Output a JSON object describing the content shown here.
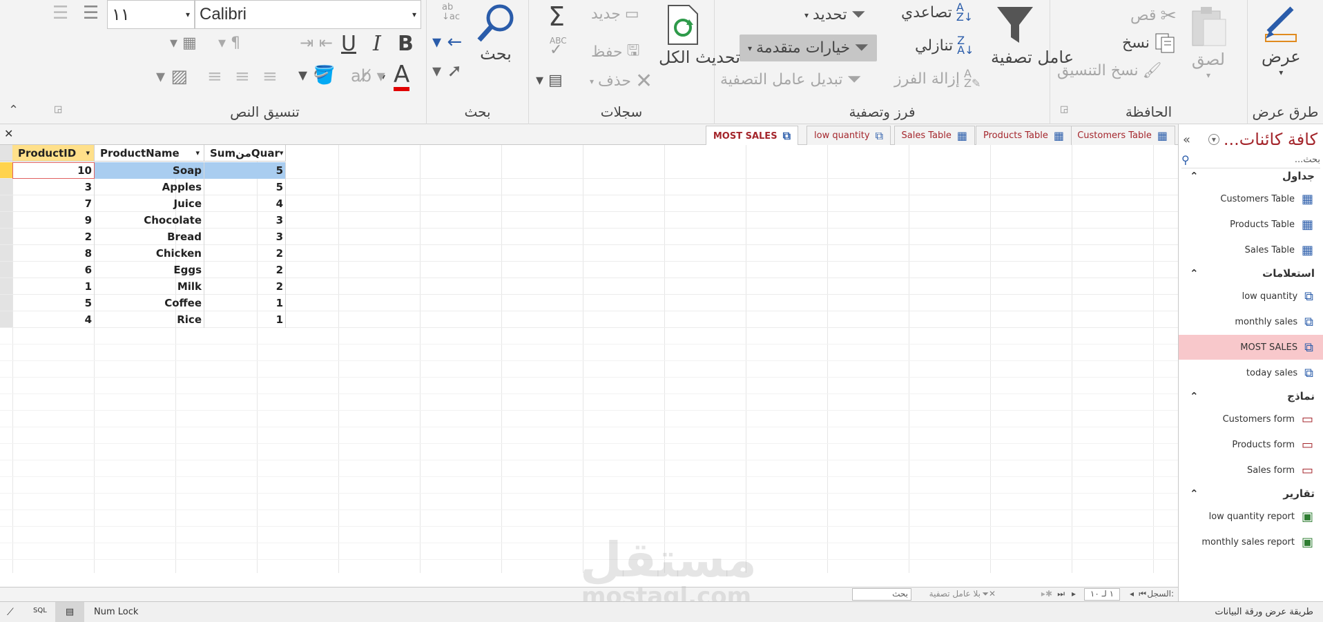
{
  "ribbon": {
    "views": {
      "label": "عرض",
      "group": "طرق عرض"
    },
    "clipboard": {
      "paste": "لصق",
      "cut": "قص",
      "copy": "نسخ",
      "format_painter": "نسخ التنسيق",
      "group": "الحافظة"
    },
    "sort_filter": {
      "filter": "عامل تصفية",
      "ascending": "تصاعدي",
      "descending": "تنازلي",
      "remove_sort": "إزالة الفرز",
      "selection": "تحديد",
      "advanced": "خيارات متقدمة",
      "toggle_filter": "تبديل عامل التصفية",
      "group": "فرز وتصفية"
    },
    "records": {
      "refresh_all": "تحديث الكل",
      "new": "جديد",
      "save": "حفظ",
      "delete": "حذف",
      "group": "سجلات"
    },
    "find": {
      "find": "بحث",
      "group": "بحث"
    },
    "text_formatting": {
      "font_name": "Calibri",
      "font_size": "١١",
      "group": "تنسيق النص",
      "bold": "B",
      "italic": "I",
      "underline": "U",
      "font_color": "A"
    }
  },
  "nav_pane": {
    "title": "كافة كائنات...",
    "search_placeholder": "بحث...",
    "sections": [
      {
        "title": "جداول",
        "items": [
          "Customers Table",
          "Products Table",
          "Sales Table"
        ]
      },
      {
        "title": "استعلامات",
        "items": [
          "low quantity",
          "monthly sales",
          "MOST SALES",
          "today sales"
        ]
      },
      {
        "title": "نماذج",
        "items": [
          "Customers form",
          "Products form",
          "Sales form"
        ]
      },
      {
        "title": "تقارير",
        "items": [
          "low quantity report",
          "monthly sales report"
        ]
      }
    ],
    "selected": "MOST SALES"
  },
  "tabs": [
    "Customers Table",
    "Products Table",
    "Sales Table",
    "low quantity",
    "MOST SALES"
  ],
  "active_tab": "MOST SALES",
  "grid": {
    "columns": [
      "ProductID",
      "ProductName",
      "SumمنQuar"
    ],
    "rows": [
      [
        "10",
        "Soap",
        "5"
      ],
      [
        "3",
        "Apples",
        "5"
      ],
      [
        "7",
        "Juice",
        "4"
      ],
      [
        "9",
        "Chocolate",
        "3"
      ],
      [
        "2",
        "Bread",
        "3"
      ],
      [
        "8",
        "Chicken",
        "2"
      ],
      [
        "6",
        "Eggs",
        "2"
      ],
      [
        "1",
        "Milk",
        "2"
      ],
      [
        "5",
        "Coffee",
        "1"
      ],
      [
        "4",
        "Rice",
        "1"
      ]
    ]
  },
  "record_nav": {
    "label": "السجل:",
    "position": "١ لـ ١٠",
    "filter": "بلا عامل تصفية",
    "search": "بحث"
  },
  "status": {
    "view_name": "طريقة عرض ورقة البيانات",
    "num_lock": "Num Lock",
    "sql": "SQL"
  },
  "watermark": {
    "arabic": "مستقل",
    "latin": "mostaql.com"
  },
  "colors": {
    "accent": "#a4262c",
    "selected_row": "#ffd34d",
    "cell_highlight": "#a9cdf0",
    "nav_selected": "#f8c8cb"
  }
}
